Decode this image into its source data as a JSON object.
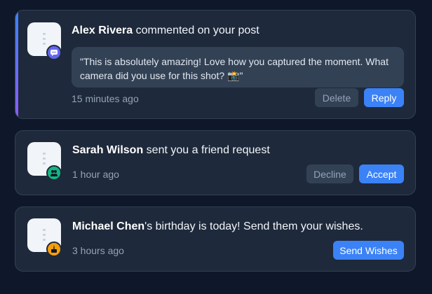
{
  "notifications": [
    {
      "user": "Alex Rivera",
      "action": " commented on your post",
      "comment": "\"This is absolutely amazing! Love how you captured the moment. What camera did you use for this shot? 📸\"",
      "time": "15 minutes ago",
      "badge_icon": "comment-icon",
      "badge_color": "#6366f1",
      "secondary_label": "Delete",
      "primary_label": "Reply",
      "unread": true
    },
    {
      "user": "Sarah Wilson",
      "action": " sent you a friend request",
      "time": "1 hour ago",
      "badge_icon": "users-icon",
      "badge_color": "#10b981",
      "secondary_label": "Decline",
      "primary_label": "Accept"
    },
    {
      "user": "Michael Chen",
      "action": "'s birthday is today! Send them your wishes.",
      "time": "3 hours ago",
      "badge_icon": "birthday-cake-icon",
      "badge_color": "#f59e0b",
      "primary_label": "Send Wishes"
    }
  ],
  "colors": {
    "background": "#0f172a",
    "card": "#1e293b",
    "accent": "#3b82f6"
  }
}
